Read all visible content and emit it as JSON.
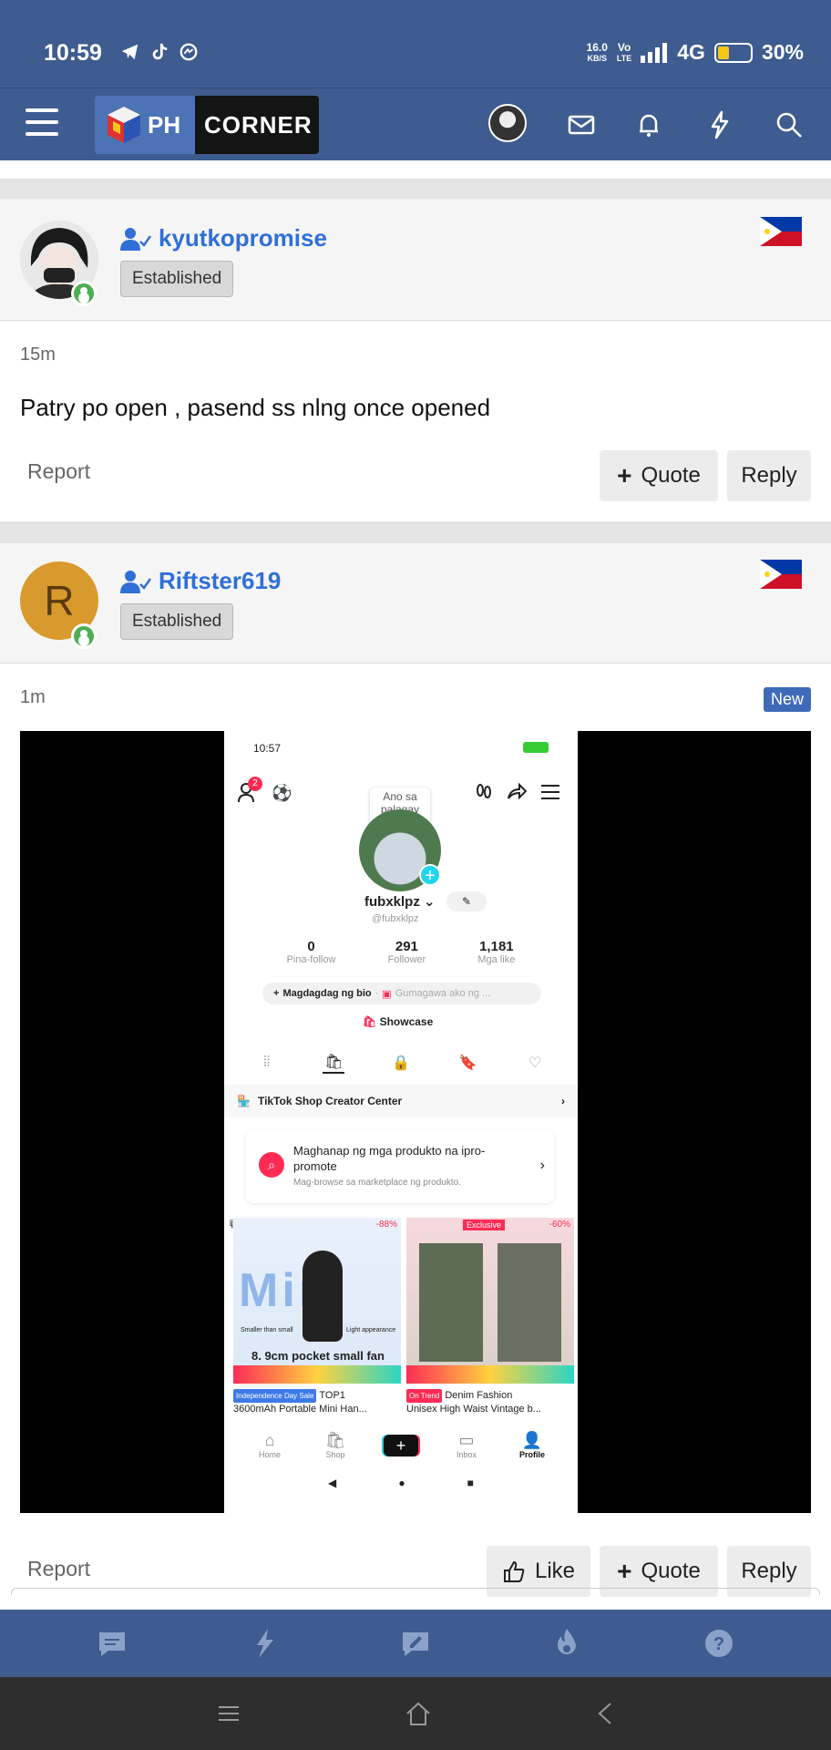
{
  "status_bar": {
    "time": "10:59",
    "speed_value": "16.0",
    "speed_unit": "KB/S",
    "volte_top": "Vo",
    "volte_bottom": "LTE",
    "network": "4G",
    "battery": "30%"
  },
  "header": {
    "logo_left": "PH",
    "logo_right": "CORNER",
    "icons": [
      "menu-icon",
      "avatar",
      "mail-icon",
      "bell-icon",
      "lightning-icon",
      "search-icon"
    ]
  },
  "posts": [
    {
      "username": "kyutkopromise",
      "badge": "Established",
      "time": "15m",
      "message": "Patry po open , pasend ss nlng once opened",
      "report": "Report",
      "quote": "Quote",
      "reply": "Reply"
    },
    {
      "username": "Riftster619",
      "avatar_letter": "R",
      "badge": "Established",
      "time": "1m",
      "new_badge": "New",
      "report": "Report",
      "like": "Like",
      "quote": "Quote",
      "reply": "Reply"
    }
  ],
  "screenshot": {
    "time": "10:57",
    "notif_count": "2",
    "bubble": "Ano sa palagay mo?",
    "username": "fubxklpz",
    "handle": "@fubxklpz",
    "stats": [
      {
        "value": "0",
        "label": "Pina-follow"
      },
      {
        "value": "291",
        "label": "Follower"
      },
      {
        "value": "1,181",
        "label": "Mga like"
      }
    ],
    "bio_add": "Magdagdag ng bio",
    "bio_alt": "Gumagawa ako ng ...",
    "showcase": "Showcase",
    "creator_center": "TikTok Shop Creator Center",
    "promo_title": "Maghanap ng mga produkto na ipro-promote",
    "promo_sub": "Mag-browse sa marketplace ng produkto.",
    "product1": {
      "discount": "-88%",
      "banner": "Mini",
      "small1": "Smaller than small",
      "small2": "Light appearance",
      "headline": "8. 9cm pocket small fan",
      "tag": "Independence Day Sale",
      "title1": "TOP1",
      "title2": "3600mAh Portable Mini Han..."
    },
    "product2": {
      "discount": "-60%",
      "exclusive": "Exclusive",
      "tag": "On Trend",
      "title1": "Denim Fashion",
      "title2": "Unisex High Waist Vintage b..."
    },
    "nav": [
      "Home",
      "Shop",
      "",
      "Inbox",
      "Profile"
    ]
  },
  "colors": {
    "brand": "#3e5c8f",
    "link": "#2f6fd6",
    "online": "#4caf50",
    "tiktok_pink": "#fe2c55"
  }
}
